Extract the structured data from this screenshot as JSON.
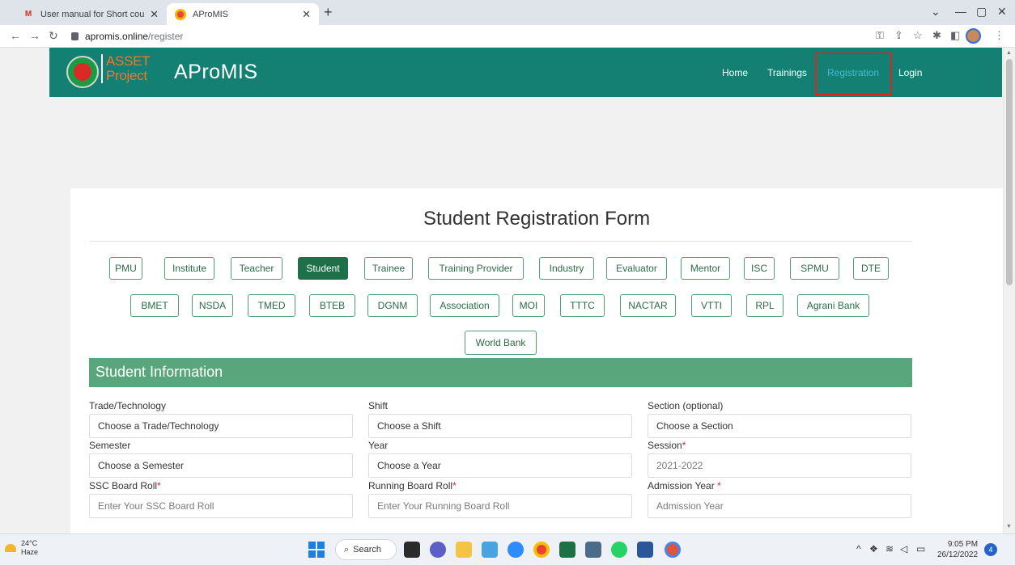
{
  "browser": {
    "tabs": [
      {
        "title": "User manual for Short course Eli...",
        "favicon": "gmail-icon",
        "active": false
      },
      {
        "title": "AProMIS",
        "favicon": "apromis-icon",
        "active": true
      }
    ],
    "new_tab": "+",
    "url_domain": "apromis.online",
    "url_path": "/register",
    "window_controls": {
      "minimize": "—",
      "maximize": "▢",
      "close": "✕",
      "tab_search": "⌄"
    }
  },
  "site": {
    "logo_line1": "ASSET",
    "logo_line2": "Project",
    "brand": "AProMIS",
    "nav": [
      "Home",
      "Trainings",
      "Registration",
      "Login"
    ],
    "current_nav": "Registration"
  },
  "form": {
    "title": "Student Registration Form",
    "roles": [
      "PMU",
      "Institute",
      "Teacher",
      "Student",
      "Trainee",
      "Training Provider",
      "Industry",
      "Evaluator",
      "Mentor",
      "ISC",
      "SPMU",
      "DTE",
      "BMET",
      "NSDA",
      "TMED",
      "BTEB",
      "DGNM",
      "Association",
      "MOI",
      "TTTC",
      "NACTAR",
      "VTTI",
      "RPL",
      "Agrani Bank",
      "World Bank"
    ],
    "active_role": "Student",
    "section_title": "Student Information",
    "fields": [
      {
        "label": "Trade/Technology",
        "required": false,
        "value": "Choose a Trade/Technology",
        "placeholder": false
      },
      {
        "label": "Shift",
        "required": false,
        "value": "Choose a Shift",
        "placeholder": false
      },
      {
        "label": "Section (optional)",
        "required": false,
        "value": "Choose a Section",
        "placeholder": false
      },
      {
        "label": "Semester",
        "required": false,
        "value": "Choose a Semester",
        "placeholder": false
      },
      {
        "label": "Year",
        "required": false,
        "value": "Choose a Year",
        "placeholder": false
      },
      {
        "label": "Session",
        "required": true,
        "value": "2021-2022",
        "placeholder": true
      },
      {
        "label": "SSC Board Roll",
        "required": true,
        "value": "Enter Your SSC Board Roll",
        "placeholder": true
      },
      {
        "label": "Running Board Roll",
        "required": true,
        "value": "Enter Your Running Board Roll",
        "placeholder": true
      },
      {
        "label": "Admission Year ",
        "required": true,
        "value": "Admission Year",
        "placeholder": true
      }
    ]
  },
  "taskbar": {
    "weather_temp": "24°C",
    "weather_desc": "Haze",
    "search_label": "Search",
    "time": "9:05 PM",
    "date": "26/12/2022",
    "notifications": "4"
  },
  "colors": {
    "header": "#148073",
    "section": "#5aa67c",
    "active_role": "#1e7048",
    "highlight": "#e02222"
  }
}
